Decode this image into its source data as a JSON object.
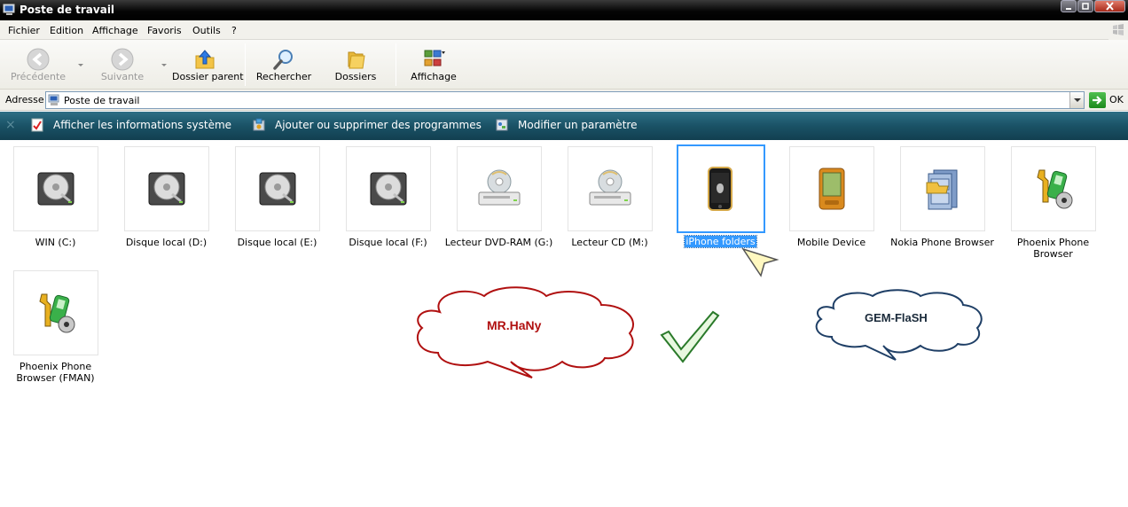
{
  "window": {
    "title": "Poste de travail"
  },
  "menu": [
    "Fichier",
    "Edition",
    "Affichage",
    "Favoris",
    "Outils",
    "?"
  ],
  "toolbar": {
    "back": "Précédente",
    "forward": "Suivante",
    "up": "Dossier parent",
    "search": "Rechercher",
    "folders": "Dossiers",
    "views": "Affichage"
  },
  "address": {
    "label": "Adresse",
    "value": "Poste de travail",
    "go": "OK"
  },
  "tasks": [
    "Afficher les informations système",
    "Ajouter ou supprimer des programmes",
    "Modifier un paramètre"
  ],
  "items": [
    {
      "label": "WIN (C:)",
      "icon": "hard-drive-icon"
    },
    {
      "label": "Disque local (D:)",
      "icon": "hard-drive-icon"
    },
    {
      "label": "Disque local (E:)",
      "icon": "hard-drive-icon"
    },
    {
      "label": "Disque local (F:)",
      "icon": "hard-drive-icon"
    },
    {
      "label": "Lecteur DVD-RAM (G:)",
      "icon": "dvd-drive-icon"
    },
    {
      "label": "Lecteur CD (M:)",
      "icon": "cd-drive-icon"
    },
    {
      "label": "iPhone folders",
      "icon": "iphone-icon",
      "selected": true
    },
    {
      "label": "Mobile Device",
      "icon": "pda-icon"
    },
    {
      "label": "Nokia Phone Browser",
      "icon": "filing-cabinet-icon"
    },
    {
      "label": "Phoenix Phone Browser",
      "icon": "phone-tool-icon"
    },
    {
      "label": "Phoenix Phone Browser (FMAN)",
      "icon": "phone-tool-icon"
    }
  ],
  "annotations": {
    "bubble_left": "MR.HaNy",
    "bubble_right": "GEM-FlaSH",
    "colors": {
      "red": "#b01010",
      "blue": "#1f3f66",
      "selection": "#3399ff"
    }
  }
}
